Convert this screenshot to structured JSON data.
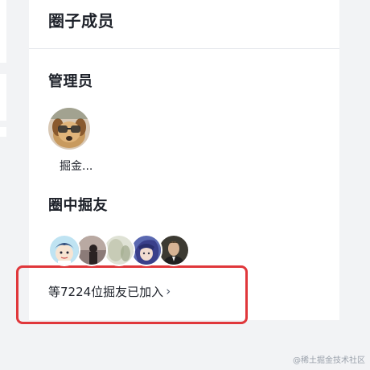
{
  "panel": {
    "title": "圈子成员"
  },
  "admins": {
    "title": "管理员",
    "members": [
      {
        "name": "掘金...",
        "avatar_icon": "puppy-with-glasses-avatar"
      }
    ]
  },
  "friends": {
    "title": "圈中掘友",
    "avatars": [
      {
        "avatar_icon": "cartoon-boy-avatar"
      },
      {
        "avatar_icon": "silhouette-avatar"
      },
      {
        "avatar_icon": "blurry-light-avatar"
      },
      {
        "avatar_icon": "anime-character-avatar"
      },
      {
        "avatar_icon": "man-in-suit-avatar"
      }
    ],
    "join_text": "等7224位掘友已加入",
    "join_chevron": "›"
  },
  "annotation": {
    "highlight_color": "#e0373b"
  },
  "watermark": "@稀土掘金技术社区"
}
